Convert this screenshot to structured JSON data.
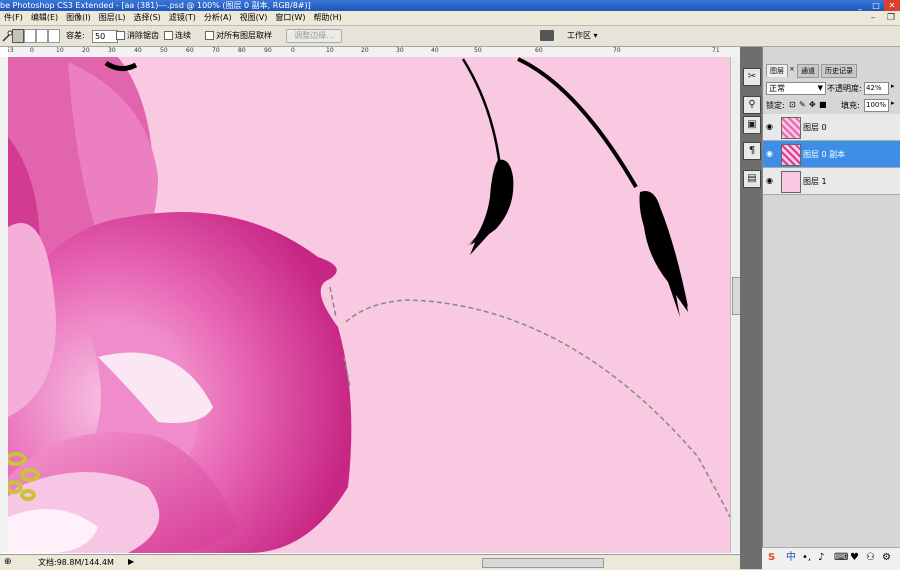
{
  "title": "be Photoshop CS3 Extended - [aa (381)---.psd @ 100% (图层 0 副本, RGB/8#)]",
  "window_controls": {
    "min": "_",
    "max": "□",
    "close": "✕"
  },
  "menu": [
    "件(F)",
    "编辑(E)",
    "图像(I)",
    "图层(L)",
    "选择(S)",
    "滤镜(T)",
    "分析(A)",
    "视图(V)",
    "窗口(W)",
    "帮助(H)"
  ],
  "doc_controls": {
    "min": "–",
    "restore": "❐"
  },
  "options": {
    "tolerance_label": "容差:",
    "tolerance_value": "50",
    "antialias_label": "消除锯齿",
    "contiguous_label": "连续",
    "sample_all_label": "对所有图层取样",
    "refine_edge_label": "调整边缘...",
    "workspace_label": "工作区 ▾"
  },
  "ruler_ticks": [
    "53",
    "0",
    "10",
    "20",
    "30",
    "40",
    "50",
    "60",
    "70",
    "80",
    "90",
    "0",
    "10",
    "20",
    "30",
    "40",
    "50",
    "60",
    "70",
    "71"
  ],
  "status": {
    "doc": "文档:98.8M/144.4M"
  },
  "layers_panel": {
    "tabs": [
      "图层",
      "通道",
      "历史记录"
    ],
    "blend_mode": "正常",
    "opacity_label": "不透明度:",
    "opacity_value": "42%",
    "lock_label": "锁定:",
    "fill_label": "填充:",
    "fill_value": "100%",
    "layers": [
      {
        "name": "图层 0",
        "selected": false
      },
      {
        "name": "图层 0 副本",
        "selected": true
      },
      {
        "name": "图层 1",
        "selected": false
      }
    ]
  },
  "taskbar": {
    "ime": "中"
  },
  "colors": {
    "canvas_bg": "#f9c9e2",
    "petal_dark": "#d63a96",
    "petal_mid": "#e866b5",
    "petal_light": "#f6b5dd",
    "selection": "#3d8ee6"
  }
}
